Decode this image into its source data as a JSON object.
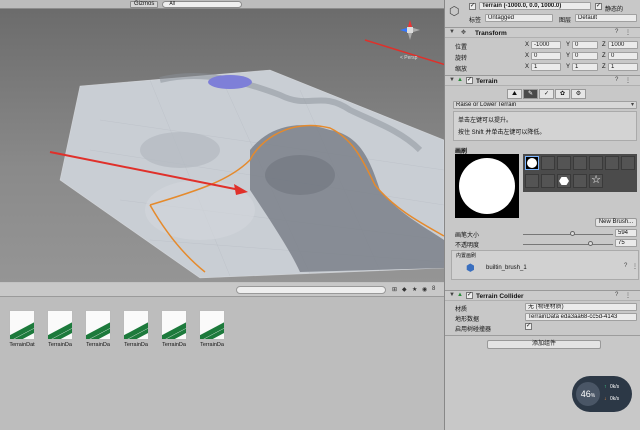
{
  "scene": {
    "gizmos_label": "Gizmos",
    "search_placeholder": "All",
    "persp_label": "< Persp"
  },
  "project": {
    "assets": [
      {
        "label": "TerrainDat"
      },
      {
        "label": "TerrainDa"
      },
      {
        "label": "TerrainDa"
      },
      {
        "label": "TerrainDa"
      },
      {
        "label": "TerrainDa"
      },
      {
        "label": "TerrainDa"
      }
    ],
    "hidden_count": "8"
  },
  "inspector": {
    "object_name": "Terrain (-1000.0, 0.0, 1000.0)",
    "static_label": "静态的",
    "tag_label": "标签",
    "tag_value": "Untagged",
    "layer_label": "图层",
    "layer_value": "Default",
    "transform": {
      "title": "Transform",
      "rows": [
        {
          "label": "位置",
          "x": "-1000",
          "y": "0",
          "z": "1000"
        },
        {
          "label": "旋转",
          "x": "0",
          "y": "0",
          "z": "0"
        },
        {
          "label": "缩放",
          "x": "1",
          "y": "1",
          "z": "1"
        }
      ],
      "axis_x": "X",
      "axis_y": "Y",
      "axis_z": "Z"
    },
    "terrain": {
      "title": "Terrain",
      "tool_dropdown": "Raise or Lower Terrain",
      "help1": "单击左键可以提升。",
      "help2": "按住 Shift 并单击左键可以降低。",
      "brush_title": "画刷",
      "new_brush": "New Brush...",
      "brush_size_label": "画笔大小",
      "brush_size_value": "594",
      "brush_size_level": 0.56,
      "opacity_label": "不透明度",
      "opacity_value": "75",
      "opacity_level": 0.75,
      "builtin_label": "内置画刷",
      "builtin_name": "builtin_brush_1"
    },
    "collider": {
      "title": "Terrain Collider",
      "material_label": "材质",
      "material_value": "无 (物理材质)",
      "data_label": "地形数据",
      "data_value": "TerrainData eda3aa68-cc5d-4143",
      "tree_label": "启用树碰撞器"
    },
    "add_component": "添加组件"
  },
  "fps": {
    "value": "46",
    "unit": "%",
    "up": "0k/s",
    "down": "0k/s"
  }
}
